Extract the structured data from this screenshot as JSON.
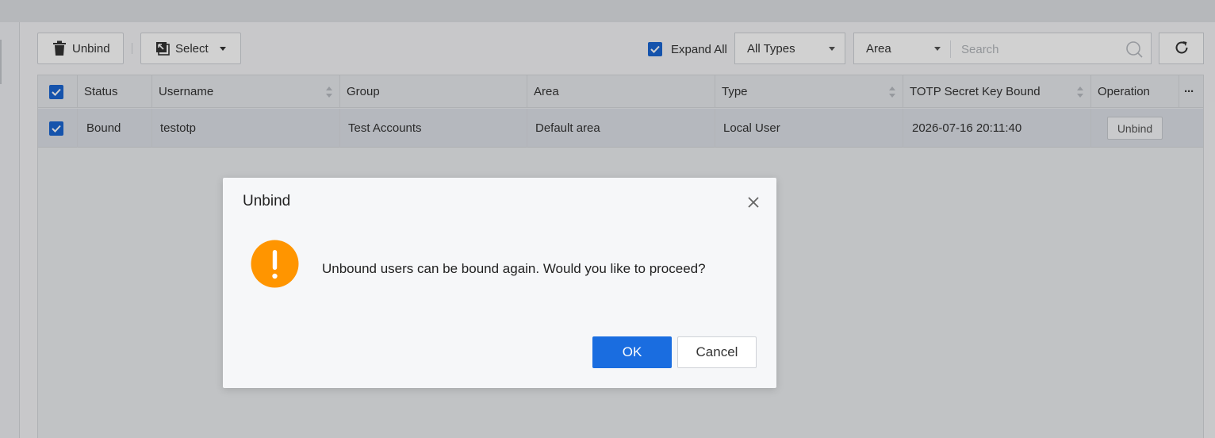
{
  "toolbar": {
    "unbind_label": "Unbind",
    "select_label": "Select",
    "expand_all_label": "Expand All",
    "expand_all_checked": true,
    "types_value": "All Types",
    "area_value": "Area",
    "search_placeholder": "Search"
  },
  "table": {
    "columns": [
      "Status",
      "Username",
      "Group",
      "Area",
      "Type",
      "TOTP Secret Key Bound",
      "Operation"
    ],
    "more_label": "···",
    "rows": [
      {
        "checked": true,
        "status": "Bound",
        "username": "testotp",
        "group": "Test Accounts",
        "area": "Default area",
        "type": "Local User",
        "totp_bound": "2026-07-16 20:11:40",
        "operation_label": "Unbind"
      }
    ]
  },
  "dialog": {
    "title": "Unbind",
    "message": "Unbound users can be bound again. Would you like to proceed?",
    "ok_label": "OK",
    "cancel_label": "Cancel"
  },
  "colors": {
    "primary": "#1a6de0",
    "checkbox": "#1a66d2",
    "warning": "#ff9500"
  },
  "icons": [
    "trash-icon",
    "select-icon",
    "chevron-down-icon",
    "check-icon",
    "search-icon",
    "refresh-icon",
    "sort-icon",
    "more-icon",
    "close-icon",
    "warning-icon"
  ]
}
